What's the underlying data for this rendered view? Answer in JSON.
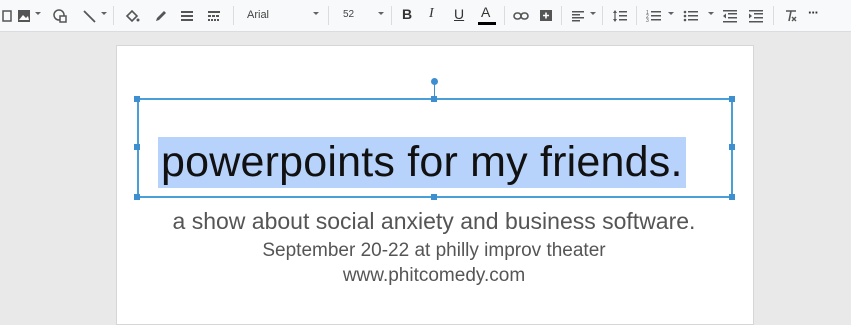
{
  "toolbar": {
    "font_name": "Arial",
    "font_size": "52",
    "bold_label": "B",
    "italic_label": "I",
    "underline_label": "U",
    "text_color_label": "A",
    "more_label": "···",
    "icons": [
      "select-icon",
      "image-icon",
      "shape-icon",
      "line-icon",
      "fill-color-icon",
      "border-color-icon",
      "border-weight-icon",
      "border-dash-icon",
      "bold-icon",
      "italic-icon",
      "underline-icon",
      "text-color-icon",
      "link-icon",
      "add-comment-icon",
      "align-icon",
      "line-spacing-icon",
      "numbered-list-icon",
      "bulleted-list-icon",
      "decrease-indent-icon",
      "increase-indent-icon",
      "clear-formatting-icon",
      "more-icon"
    ]
  },
  "slide": {
    "title": "powerpoints for my friends.",
    "subtitle": "a show about social anxiety and business software.",
    "dates": "September 20-22 at philly improv theater",
    "website": "www.phitcomedy.com"
  },
  "colors": {
    "selection": "#4a9fd8",
    "highlight": "#b7d3fb",
    "toolbar_bg": "#f8f9fa",
    "canvas_bg": "#e9e9e9"
  }
}
